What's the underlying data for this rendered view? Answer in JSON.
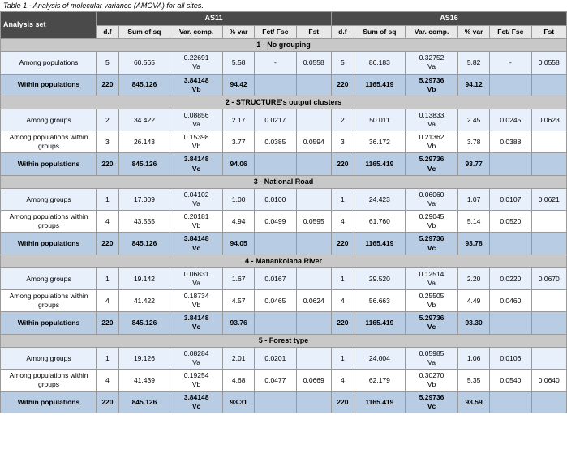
{
  "title": "Table 1 - Analysis of molecular variance (AMOVA) for all sites.",
  "headers": {
    "analysis_set": "Analysis set",
    "as11": "AS11",
    "as16": "AS16",
    "columns": [
      "d.f",
      "Sum of sq",
      "Var. comp.",
      "% var",
      "Fct/ Fsc",
      "Fst",
      "d.f",
      "Sum of sq",
      "Var. comp.",
      "% var",
      "Fct/ Fsc",
      "Fst"
    ]
  },
  "sections": [
    {
      "id": "s1",
      "label": "1 - No grouping",
      "rows": [
        {
          "source": "Among populations",
          "as11": {
            "df": "5",
            "sumsq": "60.565",
            "varcomp": "0.22691\nVa",
            "pvar": "5.58",
            "fctfsc": "-",
            "fst": "0.0558"
          },
          "as16": {
            "df": "5",
            "sumsq": "86.183",
            "varcomp": "0.32752\nVa",
            "pvar": "5.82",
            "fctfsc": "-",
            "fst": "0.0558"
          },
          "type": "light"
        },
        {
          "source": "Within populations",
          "as11": {
            "df": "220",
            "sumsq": "845.126",
            "varcomp": "3.84148\nVb",
            "pvar": "94.42",
            "fctfsc": "",
            "fst": ""
          },
          "as16": {
            "df": "220",
            "sumsq": "1165.419",
            "varcomp": "5.29736\nVb",
            "pvar": "94.12",
            "fctfsc": "",
            "fst": ""
          },
          "type": "within"
        }
      ]
    },
    {
      "id": "s2",
      "label": "2 - STRUCTURE's output clusters",
      "rows": [
        {
          "source": "Among groups",
          "as11": {
            "df": "2",
            "sumsq": "34.422",
            "varcomp": "0.08856\nVa",
            "pvar": "2.17",
            "fctfsc": "0.0217",
            "fst": ""
          },
          "as16": {
            "df": "2",
            "sumsq": "50.011",
            "varcomp": "0.13833\nVa",
            "pvar": "2.45",
            "fctfsc": "0.0245",
            "fst": "0.0623"
          },
          "type": "light"
        },
        {
          "source": "Among populations within groups",
          "as11": {
            "df": "3",
            "sumsq": "26.143",
            "varcomp": "0.15398\nVb",
            "pvar": "3.77",
            "fctfsc": "0.0385",
            "fst": "0.0594"
          },
          "as16": {
            "df": "3",
            "sumsq": "36.172",
            "varcomp": "0.21362\nVb",
            "pvar": "3.78",
            "fctfsc": "0.0388",
            "fst": ""
          },
          "type": "white"
        },
        {
          "source": "Within populations",
          "as11": {
            "df": "220",
            "sumsq": "845.126",
            "varcomp": "3.84148\nVc",
            "pvar": "94.06",
            "fctfsc": "",
            "fst": ""
          },
          "as16": {
            "df": "220",
            "sumsq": "1165.419",
            "varcomp": "5.29736\nVc",
            "pvar": "93.77",
            "fctfsc": "",
            "fst": ""
          },
          "type": "within"
        }
      ]
    },
    {
      "id": "s3",
      "label": "3 - National Road",
      "rows": [
        {
          "source": "Among groups",
          "as11": {
            "df": "1",
            "sumsq": "17.009",
            "varcomp": "0.04102\nVa",
            "pvar": "1.00",
            "fctfsc": "0.0100",
            "fst": ""
          },
          "as16": {
            "df": "1",
            "sumsq": "24.423",
            "varcomp": "0.06060\nVa",
            "pvar": "1.07",
            "fctfsc": "0.0107",
            "fst": "0.0621"
          },
          "type": "light"
        },
        {
          "source": "Among populations within groups",
          "as11": {
            "df": "4",
            "sumsq": "43.555",
            "varcomp": "0.20181\nVb",
            "pvar": "4.94",
            "fctfsc": "0.0499",
            "fst": "0.0595"
          },
          "as16": {
            "df": "4",
            "sumsq": "61.760",
            "varcomp": "0.29045\nVb",
            "pvar": "5.14",
            "fctfsc": "0.0520",
            "fst": ""
          },
          "type": "white"
        },
        {
          "source": "Within populations",
          "as11": {
            "df": "220",
            "sumsq": "845.126",
            "varcomp": "3.84148\nVc",
            "pvar": "94.05",
            "fctfsc": "",
            "fst": ""
          },
          "as16": {
            "df": "220",
            "sumsq": "1165.419",
            "varcomp": "5.29736\nVc",
            "pvar": "93.78",
            "fctfsc": "",
            "fst": ""
          },
          "type": "within"
        }
      ]
    },
    {
      "id": "s4",
      "label": "4 - Manankolana River",
      "rows": [
        {
          "source": "Among groups",
          "as11": {
            "df": "1",
            "sumsq": "19.142",
            "varcomp": "0.06831\nVa",
            "pvar": "1.67",
            "fctfsc": "0.0167",
            "fst": ""
          },
          "as16": {
            "df": "1",
            "sumsq": "29.520",
            "varcomp": "0.12514\nVa",
            "pvar": "2.20",
            "fctfsc": "0.0220",
            "fst": "0.0670"
          },
          "type": "light"
        },
        {
          "source": "Among populations within groups",
          "as11": {
            "df": "4",
            "sumsq": "41.422",
            "varcomp": "0.18734\nVb",
            "pvar": "4.57",
            "fctfsc": "0.0465",
            "fst": "0.0624"
          },
          "as16": {
            "df": "4",
            "sumsq": "56.663",
            "varcomp": "0.25505\nVb",
            "pvar": "4.49",
            "fctfsc": "0.0460",
            "fst": ""
          },
          "type": "white"
        },
        {
          "source": "Within populations",
          "as11": {
            "df": "220",
            "sumsq": "845.126",
            "varcomp": "3.84148\nVc",
            "pvar": "93.76",
            "fctfsc": "",
            "fst": ""
          },
          "as16": {
            "df": "220",
            "sumsq": "1165.419",
            "varcomp": "5.29736\nVc",
            "pvar": "93.30",
            "fctfsc": "",
            "fst": ""
          },
          "type": "within"
        }
      ]
    },
    {
      "id": "s5",
      "label": "5 - Forest type",
      "rows": [
        {
          "source": "Among groups",
          "as11": {
            "df": "1",
            "sumsq": "19.126",
            "varcomp": "0.08284\nVa",
            "pvar": "2.01",
            "fctfsc": "0.0201",
            "fst": ""
          },
          "as16": {
            "df": "1",
            "sumsq": "24.004",
            "varcomp": "0.05985\nVa",
            "pvar": "1.06",
            "fctfsc": "0.0106",
            "fst": ""
          },
          "type": "light"
        },
        {
          "source": "Among populations within groups",
          "as11": {
            "df": "4",
            "sumsq": "41.439",
            "varcomp": "0.19254\nVb",
            "pvar": "4.68",
            "fctfsc": "0.0477",
            "fst": "0.0669"
          },
          "as16": {
            "df": "4",
            "sumsq": "62.179",
            "varcomp": "0.30270\nVb",
            "pvar": "5.35",
            "fctfsc": "0.0540",
            "fst": "0.0640"
          },
          "type": "white"
        },
        {
          "source": "Within populations",
          "as11": {
            "df": "220",
            "sumsq": "845.126",
            "varcomp": "3.84148\nVc",
            "pvar": "93.31",
            "fctfsc": "",
            "fst": ""
          },
          "as16": {
            "df": "220",
            "sumsq": "1165.419",
            "varcomp": "5.29736\nVc",
            "pvar": "93.59",
            "fctfsc": "",
            "fst": ""
          },
          "type": "within"
        }
      ]
    }
  ]
}
